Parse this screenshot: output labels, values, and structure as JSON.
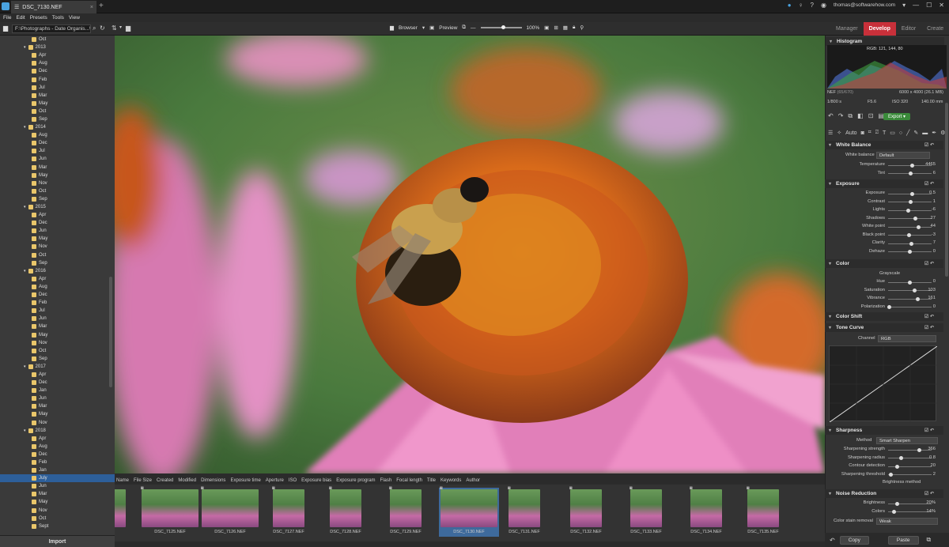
{
  "titlebar": {
    "tab_title": "DSC_7130.NEF",
    "account": "thomas@softwarehow.com"
  },
  "menu": [
    "File",
    "Edit",
    "Presets",
    "Tools",
    "View"
  ],
  "toolbar": {
    "path": "F:\\Photographs - Date Organis...\\July",
    "browser_label": "Browser",
    "preview_label": "Preview",
    "zoom": "100%"
  },
  "modes": [
    "Manager",
    "Develop",
    "Editor",
    "Create"
  ],
  "tree": [
    {
      "t": "Oct",
      "d": 3
    },
    {
      "t": "2013",
      "d": 1
    },
    {
      "t": "Apr",
      "d": 3
    },
    {
      "t": "Aug",
      "d": 3
    },
    {
      "t": "Dec",
      "d": 3
    },
    {
      "t": "Feb",
      "d": 3
    },
    {
      "t": "Jul",
      "d": 3
    },
    {
      "t": "Mar",
      "d": 3
    },
    {
      "t": "May",
      "d": 3
    },
    {
      "t": "Oct",
      "d": 3
    },
    {
      "t": "Sep",
      "d": 3
    },
    {
      "t": "2014",
      "d": 1
    },
    {
      "t": "Aug",
      "d": 3
    },
    {
      "t": "Dec",
      "d": 3
    },
    {
      "t": "Jul",
      "d": 3
    },
    {
      "t": "Jun",
      "d": 3
    },
    {
      "t": "Mar",
      "d": 3
    },
    {
      "t": "May",
      "d": 3
    },
    {
      "t": "Nov",
      "d": 3
    },
    {
      "t": "Oct",
      "d": 3
    },
    {
      "t": "Sep",
      "d": 3
    },
    {
      "t": "2015",
      "d": 1
    },
    {
      "t": "Apr",
      "d": 3
    },
    {
      "t": "Dec",
      "d": 3
    },
    {
      "t": "Jun",
      "d": 3
    },
    {
      "t": "May",
      "d": 3
    },
    {
      "t": "Nov",
      "d": 3
    },
    {
      "t": "Oct",
      "d": 3
    },
    {
      "t": "Sep",
      "d": 3
    },
    {
      "t": "2016",
      "d": 1
    },
    {
      "t": "Apr",
      "d": 3
    },
    {
      "t": "Aug",
      "d": 3
    },
    {
      "t": "Dec",
      "d": 3
    },
    {
      "t": "Feb",
      "d": 3
    },
    {
      "t": "Jul",
      "d": 3
    },
    {
      "t": "Jun",
      "d": 3
    },
    {
      "t": "Mar",
      "d": 3
    },
    {
      "t": "May",
      "d": 3
    },
    {
      "t": "Nov",
      "d": 3
    },
    {
      "t": "Oct",
      "d": 3
    },
    {
      "t": "Sep",
      "d": 3
    },
    {
      "t": "2017",
      "d": 1
    },
    {
      "t": "Apr",
      "d": 3
    },
    {
      "t": "Dec",
      "d": 3
    },
    {
      "t": "Jan",
      "d": 3
    },
    {
      "t": "Jun",
      "d": 3
    },
    {
      "t": "Mar",
      "d": 3
    },
    {
      "t": "May",
      "d": 3
    },
    {
      "t": "Nov",
      "d": 3
    },
    {
      "t": "2018",
      "d": 1
    },
    {
      "t": "Apr",
      "d": 3
    },
    {
      "t": "Aug",
      "d": 3
    },
    {
      "t": "Dec",
      "d": 3
    },
    {
      "t": "Feb",
      "d": 3
    },
    {
      "t": "Jan",
      "d": 3
    },
    {
      "t": "July",
      "d": 3,
      "sel": true
    },
    {
      "t": "Jun",
      "d": 3
    },
    {
      "t": "Mar",
      "d": 3
    },
    {
      "t": "May",
      "d": 3
    },
    {
      "t": "Nov",
      "d": 3
    },
    {
      "t": "Oct",
      "d": 3
    },
    {
      "t": "Sept",
      "d": 3
    }
  ],
  "import_label": "Import",
  "meta_columns": [
    "Name",
    "File Size",
    "Created",
    "Modified",
    "Dimensions",
    "Exposure time",
    "Aperture",
    "ISO",
    "Exposure bias",
    "Exposure program",
    "Flash",
    "Focal length",
    "Title",
    "Keywords",
    "Author"
  ],
  "thumbnails": [
    "",
    "DSC_7125.NEF",
    "DSC_7126.NEF",
    "DSC_7127.NEF",
    "DSC_7128.NEF",
    "DSC_7129.NEF",
    "DSC_7130.NEF",
    "DSC_7131.NEF",
    "DSC_7132.NEF",
    "DSC_7133.NEF",
    "DSC_7134.NEF",
    "DSC_7135.NEF"
  ],
  "selected_thumb": "DSC_7130.NEF",
  "histogram": {
    "title": "Histogram",
    "rgb": "RGB: 121, 144, 80",
    "format": "NEF",
    "count": "(65/670)",
    "dims": "6000 x 4000 (26.1 MB)",
    "shutter": "1/800 s",
    "aperture": "F5.6",
    "iso": "ISO 320",
    "focal": "140.00 mm"
  },
  "export_label": "Export",
  "auto_label": "Auto",
  "white_balance": {
    "title": "White Balance",
    "wb_label": "White balance",
    "wb_value": "Default",
    "rows": [
      {
        "l": "Temperature",
        "v": "4465",
        "p": 0.55
      },
      {
        "l": "Tint",
        "v": "6",
        "p": 0.52
      }
    ]
  },
  "exposure": {
    "title": "Exposure",
    "rows": [
      {
        "l": "Exposure",
        "v": "0.5",
        "p": 0.55
      },
      {
        "l": "Contrast",
        "v": "1",
        "p": 0.51
      },
      {
        "l": "Lights",
        "v": "-6",
        "p": 0.46
      },
      {
        "l": "Shadows",
        "v": "27",
        "p": 0.62
      },
      {
        "l": "White point",
        "v": "44",
        "p": 0.7
      },
      {
        "l": "Black point",
        "v": "-3",
        "p": 0.48
      },
      {
        "l": "Clarity",
        "v": "7",
        "p": 0.53
      },
      {
        "l": "Dehaze",
        "v": "0",
        "p": 0.5
      }
    ]
  },
  "color": {
    "title": "Color",
    "grayscale": "Grayscale",
    "rows": [
      {
        "l": "Hue",
        "v": "0",
        "p": 0.5
      },
      {
        "l": "Saturation",
        "v": "103",
        "p": 0.6
      },
      {
        "l": "Vibrance",
        "v": "161",
        "p": 0.68
      },
      {
        "l": "Polarization",
        "v": "0",
        "p": 0.02
      }
    ]
  },
  "color_shift": {
    "title": "Color Shift"
  },
  "tone_curve": {
    "title": "Tone Curve",
    "channel_label": "Channel",
    "channel_value": "RGB"
  },
  "sharpness": {
    "title": "Sharpness",
    "method_label": "Method",
    "method_value": "Smart Sharpen",
    "rows": [
      {
        "l": "Sharpening strength",
        "v": "366",
        "p": 0.72
      },
      {
        "l": "Sharpening radius",
        "v": "0.8",
        "p": 0.3
      },
      {
        "l": "Contour detection",
        "v": "20",
        "p": 0.2
      },
      {
        "l": "Sharpening threshold",
        "v": "2",
        "p": 0.06
      }
    ],
    "brightness_method": "Brightness method"
  },
  "noise": {
    "title": "Noise Reduction",
    "rows": [
      {
        "l": "Brightness",
        "v": "20%",
        "p": 0.2
      },
      {
        "l": "Colors",
        "v": "14%",
        "p": 0.14
      }
    ],
    "stain_label": "Color stain removal",
    "stain_value": "Weak"
  },
  "bottom": {
    "copy": "Copy",
    "paste": "Paste"
  }
}
